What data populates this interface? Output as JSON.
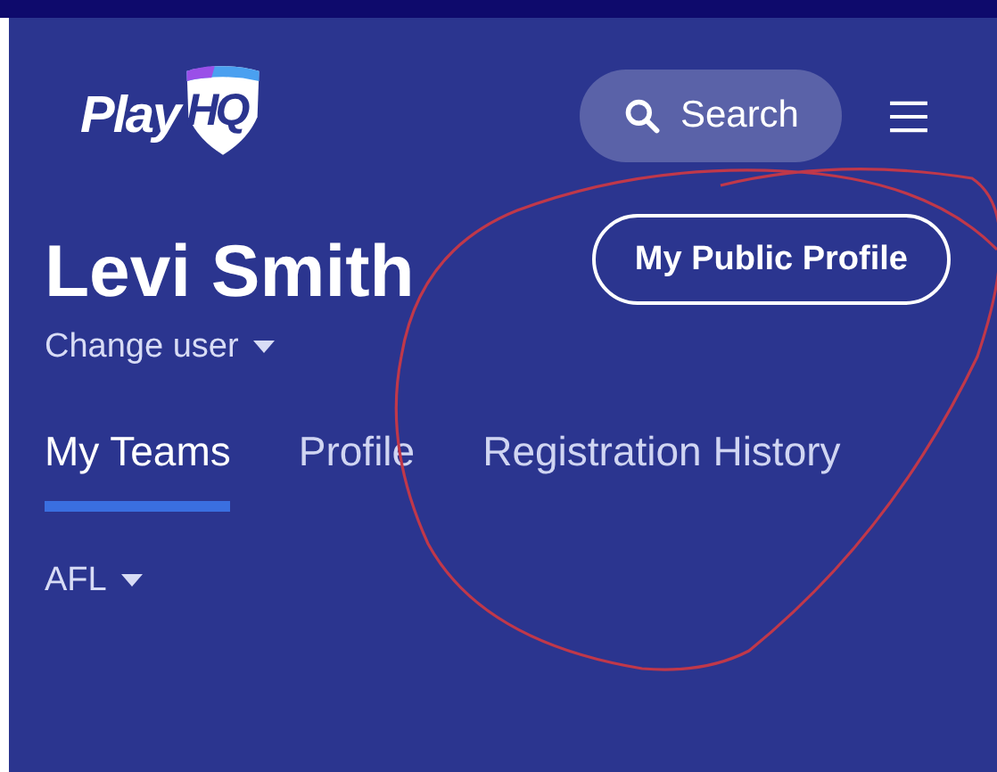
{
  "header": {
    "logo": {
      "text": "Play",
      "badge": "HQ"
    },
    "search": {
      "label": "Search"
    }
  },
  "profile": {
    "name": "Levi Smith",
    "change_user": "Change user",
    "public_profile_button": "My Public Profile"
  },
  "tabs": [
    {
      "label": "My Teams",
      "selected": true
    },
    {
      "label": "Profile",
      "selected": false
    },
    {
      "label": "Registration History",
      "selected": false
    }
  ],
  "filter": {
    "label": "AFL"
  }
}
